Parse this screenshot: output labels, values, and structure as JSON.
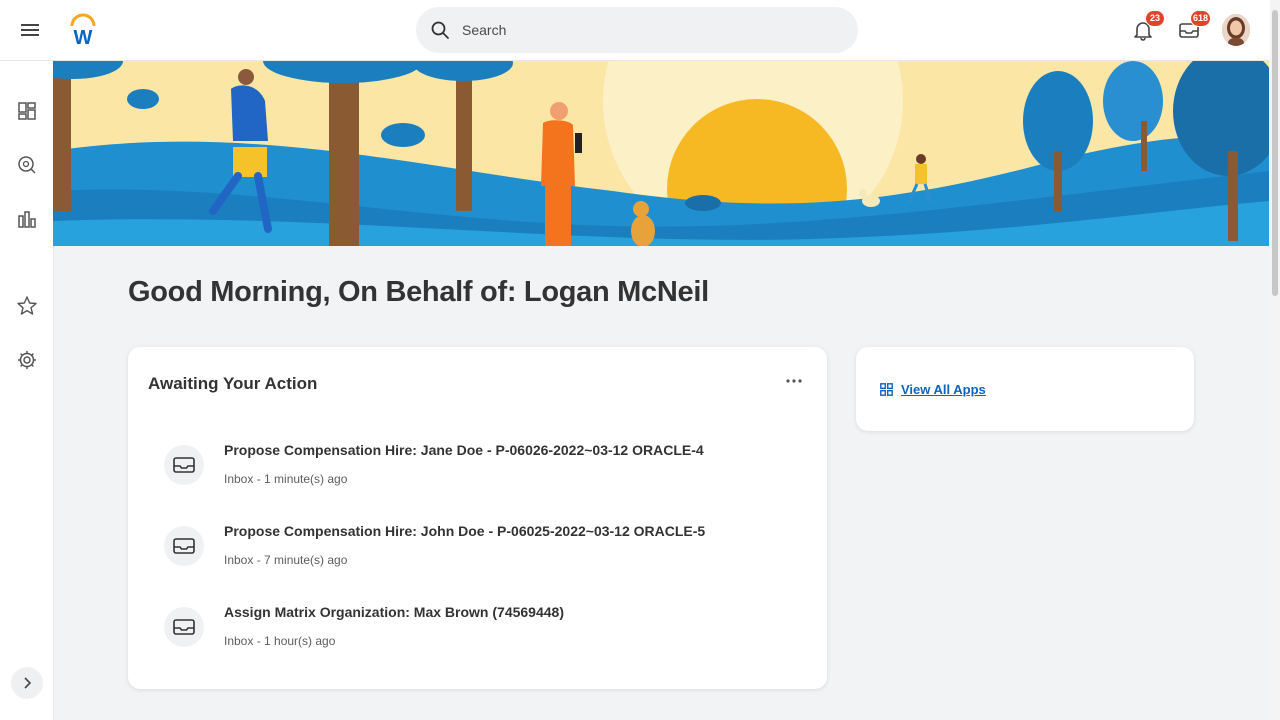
{
  "header": {
    "search_placeholder": "Search",
    "notifications_count": "23",
    "inbox_count": "618",
    "icons": [
      "menu-icon",
      "workday-logo",
      "search-icon",
      "bell-icon",
      "inbox-icon",
      "avatar"
    ]
  },
  "rail": {
    "icons": [
      "apps-grid-icon",
      "search-discover-icon",
      "chart-bars-icon",
      "star-icon",
      "gear-icon",
      "chevron-right-icon"
    ]
  },
  "greeting": "Good Morning, On Behalf of: Logan McNeil",
  "awaiting": {
    "title": "Awaiting Your Action",
    "items": [
      {
        "title": "Propose Compensation Hire: Jane Doe - P-06026-2022~03-12 ORACLE-4",
        "sub": "Inbox - 1 minute(s) ago"
      },
      {
        "title": "Propose Compensation Hire: John Doe - P-06025-2022~03-12 ORACLE-5",
        "sub": "Inbox - 7 minute(s) ago"
      },
      {
        "title": "Assign Matrix Organization: Max Brown (74569448)",
        "sub": "Inbox - 1 hour(s) ago"
      }
    ]
  },
  "apps": {
    "link": "View All Apps"
  },
  "colors": {
    "accent": "#0b64c0",
    "badge": "#e0452b",
    "banner_sky": "#fbe6a6",
    "banner_sun": "#f6b924",
    "banner_hill": "#1b7fbf"
  }
}
